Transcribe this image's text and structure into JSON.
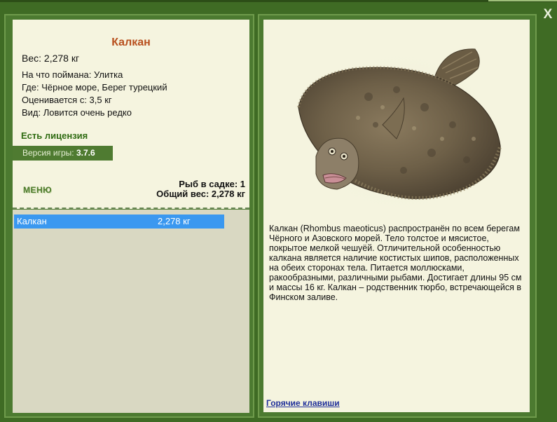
{
  "fish": {
    "name": "Калкан",
    "weight_line": "Вес: 2,278 кг",
    "bait_line": "На что поймана: Улитка",
    "location_line": "Где: Чёрное море, Берег турецкий",
    "valued_line": "Оценивается с: 3,5 кг",
    "kind_line": "Вид: Ловится очень редко"
  },
  "license": "Есть лицензия",
  "version": {
    "label": "Версия игры: ",
    "value": "3.7.6"
  },
  "menu_label": "МЕНЮ",
  "stats": {
    "fish_in_keepnet": "Рыб в садке: 1",
    "total_weight": "Общий вес: 2,278 кг"
  },
  "keepnet": [
    {
      "name": "Калкан",
      "weight": "2,278 кг"
    }
  ],
  "description": "Калкан (Rhombus maeoticus) распространён по всем берегам Чёрного и Азовского морей. Тело толстое и мясистое, покрытое мелкой чешуёй. Отличительной особенностью калкана является наличие костистых шипов, расположенных на обеих сторонах тела. Питается моллюсками, ракообразными, различными рыбами. Достигает длины 95 см и массы 16 кг. Калкан – родственник тюрбо, встречающейся в Финском заливе.",
  "hotkeys_link": "Горячие клавиши",
  "close_glyph": "X",
  "colors": {
    "background": "#3f6b24",
    "card": "#f5f4df",
    "fish_name": "#b8501e",
    "license": "#2f6b12",
    "selected_row": "#3a98f0",
    "link": "#1f2f9a"
  }
}
